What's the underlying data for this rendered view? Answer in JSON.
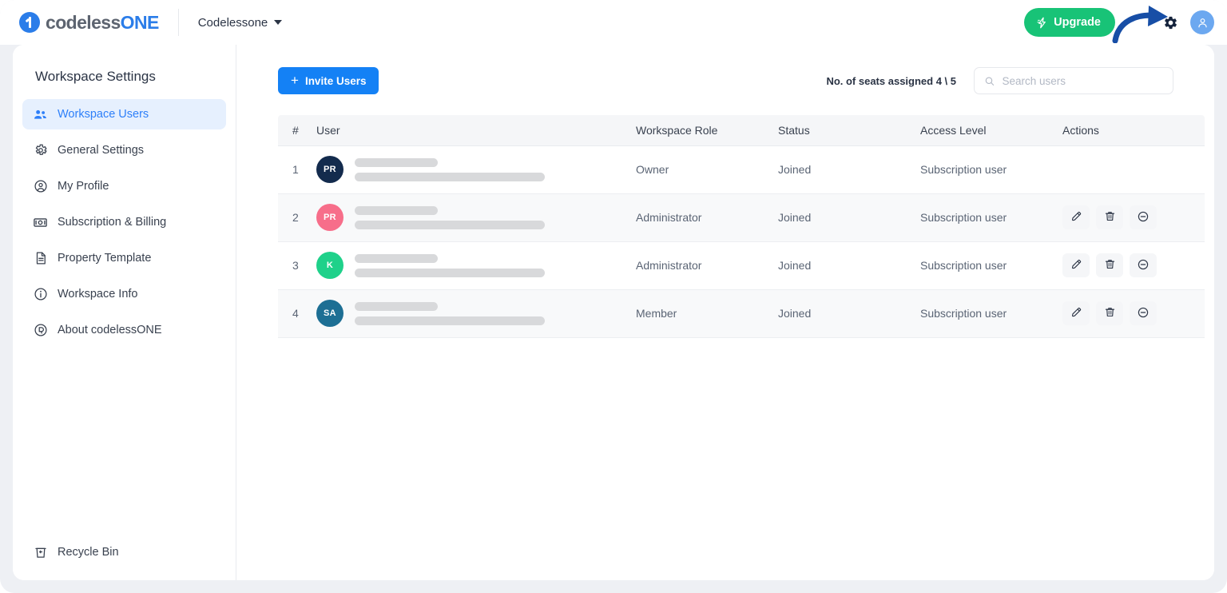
{
  "topbar": {
    "logo_name": "codelessONE",
    "logo_part_1": "codeless",
    "logo_part_2": "ONE",
    "workspace_name": "Codelessone",
    "upgrade_label": "Upgrade",
    "upgrade_color": "#18c377",
    "gear_icon": "gear-icon",
    "avatar_icon": "user-avatar-icon",
    "annotation": "curved-arrow-pointing-to-gear"
  },
  "sidebar": {
    "title": "Workspace Settings",
    "active_color": "#2d7ff9",
    "items": [
      {
        "label": "Workspace Users",
        "icon": "users-group-icon",
        "active": true
      },
      {
        "label": "General Settings",
        "icon": "gear-icon",
        "active": false
      },
      {
        "label": "My Profile",
        "icon": "user-circle-icon",
        "active": false
      },
      {
        "label": "Subscription & Billing",
        "icon": "banknote-icon",
        "active": false
      },
      {
        "label": "Property Template",
        "icon": "document-icon",
        "active": false
      },
      {
        "label": "Workspace Info",
        "icon": "info-circle-icon",
        "active": false
      },
      {
        "label": "About codelessONE",
        "icon": "about-badge-icon",
        "active": false
      }
    ],
    "footer_item": {
      "label": "Recycle Bin",
      "icon": "recycle-bin-icon"
    }
  },
  "toolbar": {
    "invite_label": "Invite Users",
    "invite_icon": "plus-icon",
    "invite_color": "#1481f5",
    "seats_label": "No. of seats assigned 4 \\ 5",
    "search": {
      "placeholder": "Search users",
      "value": "",
      "icon": "search-icon"
    }
  },
  "table": {
    "columns": [
      "#",
      "User",
      "Workspace Role",
      "Status",
      "Access Level",
      "Actions"
    ],
    "rows": [
      {
        "num": "1",
        "avatar_initials": "PR",
        "avatar_color": "#132b4d",
        "name_redacted": true,
        "role": "Owner",
        "status": "Joined",
        "access": "Subscription user",
        "actions": []
      },
      {
        "num": "2",
        "avatar_initials": "PR",
        "avatar_color": "#f76e8a",
        "name_redacted": true,
        "role": "Administrator",
        "status": "Joined",
        "access": "Subscription user",
        "actions": [
          "edit-icon",
          "trash-icon",
          "disable-icon"
        ]
      },
      {
        "num": "3",
        "avatar_initials": "K",
        "avatar_color": "#1fd18a",
        "name_redacted": true,
        "role": "Administrator",
        "status": "Joined",
        "access": "Subscription user",
        "actions": [
          "edit-icon",
          "trash-icon",
          "disable-icon"
        ]
      },
      {
        "num": "4",
        "avatar_initials": "SA",
        "avatar_color": "#1d6f94",
        "name_redacted": true,
        "role": "Member",
        "status": "Joined",
        "access": "Subscription user",
        "actions": [
          "edit-icon",
          "trash-icon",
          "disable-icon"
        ]
      }
    ]
  }
}
